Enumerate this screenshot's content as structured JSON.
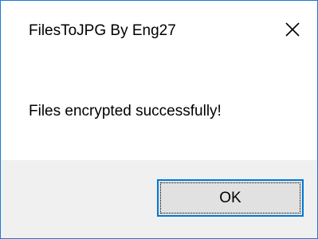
{
  "window": {
    "title": "FilesToJPG By Eng27",
    "close_icon": "close-icon"
  },
  "content": {
    "message": "Files encrypted successfully!"
  },
  "footer": {
    "ok_label": "OK"
  },
  "colors": {
    "border": "#1e78d7",
    "footer_bg": "#f0f0f0",
    "button_bg": "#e1e1e1",
    "button_focus_border": "#0078d7"
  }
}
